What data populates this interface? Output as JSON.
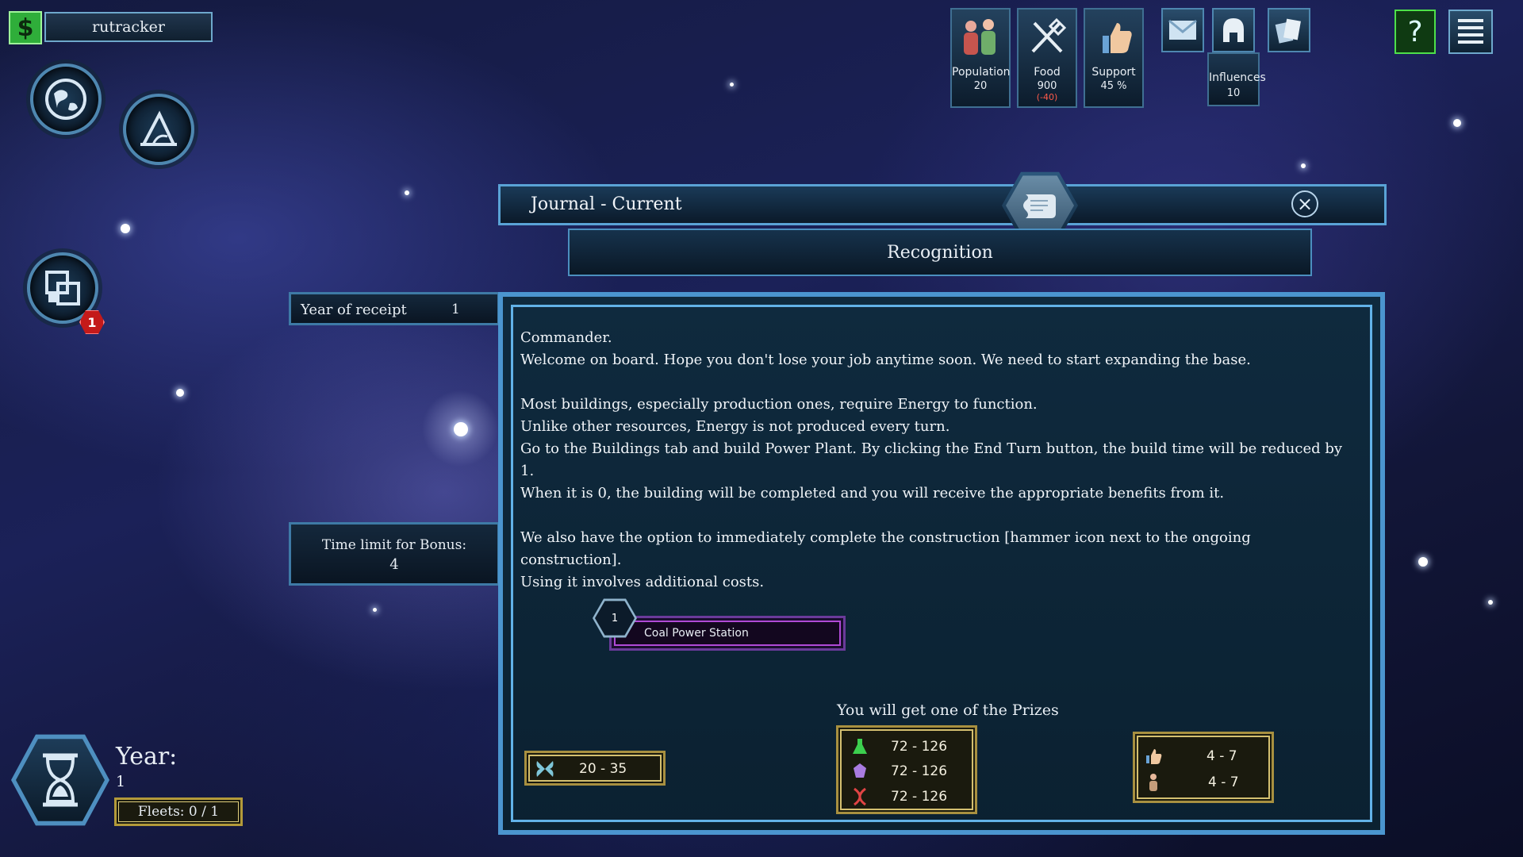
{
  "player": {
    "name": "rutracker",
    "money_icon": "dollar-icon",
    "money_symbol": "$"
  },
  "left_menu": {
    "planet_icon": "planet-icon",
    "research_icon": "compass-icon",
    "buildings_icon": "buildings-icon",
    "notification_count": "1"
  },
  "resources": {
    "population": {
      "label": "Population",
      "value": "20",
      "icon": "people-icon"
    },
    "food": {
      "label": "Food",
      "value": "900",
      "change": "(-40)",
      "icon": "fork-knife-icon"
    },
    "support": {
      "label": "Support",
      "value": "45 %",
      "icon": "thumbs-up-icon"
    },
    "influences": {
      "label": "Influences",
      "value": "10",
      "icon": "helmet-icon"
    }
  },
  "top_buttons": {
    "mail_icon": "mail-icon",
    "help_symbol": "?",
    "menu_icon": "hamburger-menu-icon",
    "cards_icon": "cards-icon"
  },
  "journal": {
    "title": "Journal - Current",
    "close_symbol": "×",
    "subtitle": "Recognition",
    "year_of_receipt_label": "Year of receipt",
    "year_of_receipt_value": "1",
    "time_limit_label": "Time limit for Bonus:",
    "time_limit_value": "4",
    "body": [
      "Commander.",
      "Welcome on board. Hope you don't lose your job anytime soon. We need to start expanding the base.",
      "",
      "Most buildings, especially production ones, require Energy to function.",
      "Unlike other resources, Energy is not produced every turn.",
      "Go to the Buildings tab and build Power Plant. By clicking the End Turn button, the build time will be reduced by 1.",
      "When it is 0, the building will be completed and you will receive the appropriate benefits from it.",
      "",
      "We also have the option to immediately complete the construction [hammer icon next to the ongoing construction].",
      "Using it involves additional costs."
    ],
    "task": {
      "count": "1",
      "name": "Coal Power Station"
    },
    "prizes_title": "You will get one of the Prizes",
    "reward_main": {
      "icon": "butterfly-icon",
      "value": "20 - 35"
    },
    "prize_resources": [
      {
        "icon": "flask-icon",
        "value": "72 - 126",
        "color": "#3ccf4e"
      },
      {
        "icon": "crystal-icon",
        "value": "72 - 126",
        "color": "#a97be0"
      },
      {
        "icon": "dna-icon",
        "value": "72 - 126",
        "color": "#e04444"
      }
    ],
    "prize_social": [
      {
        "icon": "thumbs-up-icon",
        "value": "4 - 7"
      },
      {
        "icon": "person-icon",
        "value": "4 - 7"
      }
    ]
  },
  "turn": {
    "year_label": "Year:",
    "year_value": "1",
    "fleets": "Fleets: 0 / 1",
    "end_turn_icon": "hourglass-icon"
  }
}
